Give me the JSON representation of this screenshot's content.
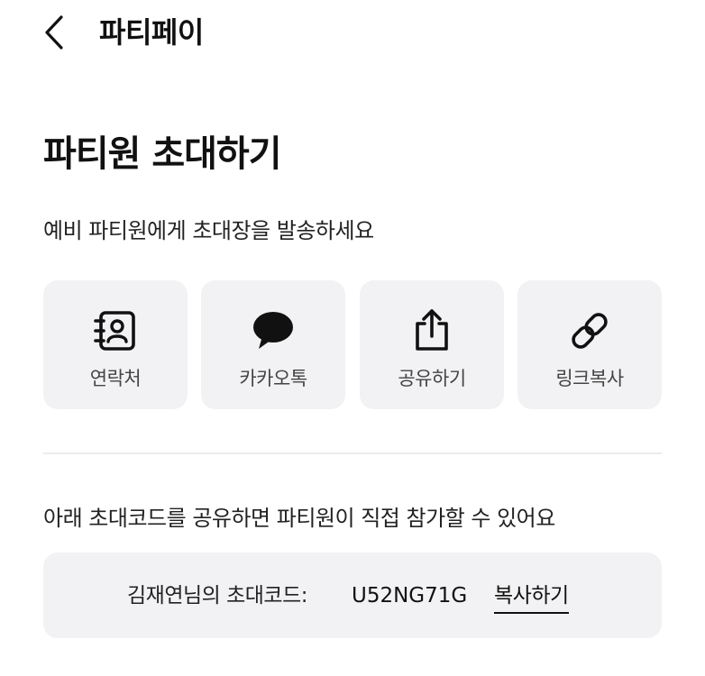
{
  "header": {
    "back_icon": "chevron-left-icon",
    "title": "파티페이"
  },
  "page_title": "파티원 초대하기",
  "subtitle": "예비 파티원에게 초대장을 발송하세요",
  "share_options": [
    {
      "label": "연락처",
      "icon": "contacts-icon"
    },
    {
      "label": "카카오톡",
      "icon": "kakaotalk-icon"
    },
    {
      "label": "공유하기",
      "icon": "share-icon"
    },
    {
      "label": "링크복사",
      "icon": "link-icon"
    }
  ],
  "info_text": "아래 초대코드를 공유하면 파티원이 직접 참가할 수 있어요",
  "invite_code": {
    "label": "김재연님의 초대코드:",
    "code": "U52NG71G",
    "copy_label": "복사하기"
  },
  "colors": {
    "tile_background": "#f2f2f4",
    "text_primary": "#111111",
    "text_secondary": "#444444",
    "divider": "#ececee"
  }
}
